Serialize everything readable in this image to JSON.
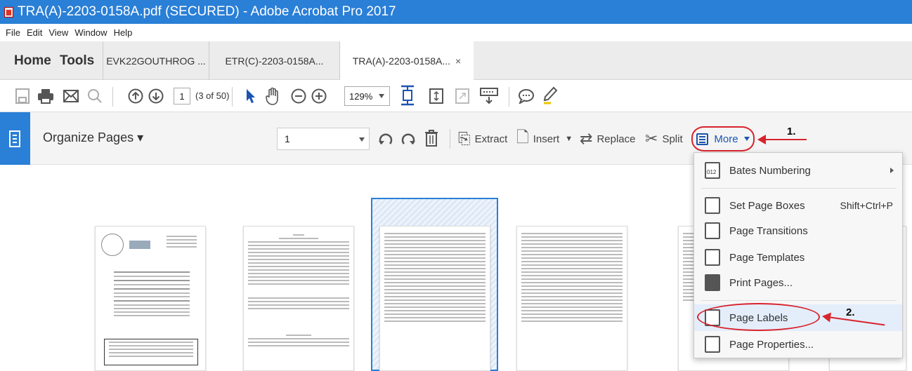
{
  "window": {
    "title": "TRA(A)-2203-0158A.pdf (SECURED) - Adobe Acrobat Pro 2017"
  },
  "menu": [
    "File",
    "Edit",
    "View",
    "Window",
    "Help"
  ],
  "nav": {
    "home": "Home",
    "tools": "Tools"
  },
  "tabs": [
    {
      "label": "EVK22GOUTHROG ..."
    },
    {
      "label": "ETR(C)-2203-0158A..."
    },
    {
      "label": "TRA(A)-2203-0158A...",
      "close": "×"
    }
  ],
  "toolbar": {
    "page_number": "1",
    "page_count": "(3 of 50)",
    "zoom": "129%"
  },
  "organize": {
    "title": "Organize Pages ▾",
    "range_value": "1",
    "extract": "Extract",
    "insert": "Insert",
    "replace": "Replace",
    "split": "Split",
    "more": "More"
  },
  "annotations": {
    "step1": "1.",
    "step2": "2."
  },
  "more_menu": [
    {
      "label": "Bates Numbering",
      "shortcut": "",
      "icon": "bates-icon"
    },
    {
      "label": "Set Page Boxes",
      "shortcut": "Shift+Ctrl+P",
      "icon": "crop-icon"
    },
    {
      "label": "Page Transitions",
      "shortcut": "",
      "icon": "transitions-icon"
    },
    {
      "label": "Page Templates",
      "shortcut": "",
      "icon": "templates-icon"
    },
    {
      "label": "Print Pages...",
      "shortcut": "",
      "icon": "print-icon"
    },
    {
      "label": "Page Labels",
      "shortcut": "",
      "icon": "page-labels-icon"
    },
    {
      "label": "Page Properties...",
      "shortcut": "",
      "icon": "page-properties-icon"
    }
  ],
  "colors": {
    "accent": "#2a7fd6",
    "annotation": "#d9232c",
    "link": "#1a55b0"
  }
}
